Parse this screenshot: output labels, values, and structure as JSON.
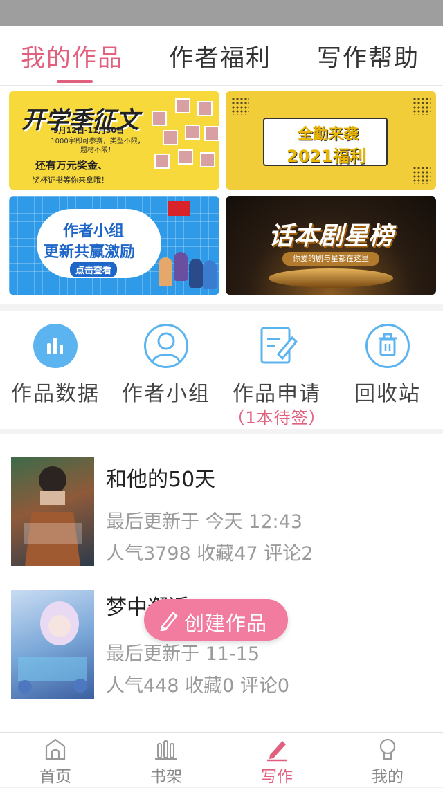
{
  "tabs": [
    {
      "label": "我的作品",
      "active": true
    },
    {
      "label": "作者福利",
      "active": false
    },
    {
      "label": "写作帮助",
      "active": false
    }
  ],
  "banners": {
    "b1": {
      "title": "开学季征文",
      "date": "9月12日-11月30日",
      "desc": "1000字即可参赛，类型不限，题材不限！",
      "prize": "还有万元奖金、",
      "prize2": "奖杯证书等你来拿哦！"
    },
    "b2": {
      "line1": "全勤来袭",
      "line2": "2021福利"
    },
    "b3": {
      "line1": "作者小组",
      "line2": "更新共赢激励",
      "button": "点击查看"
    },
    "b4": {
      "title": "话本剧星榜",
      "subtitle": "你爱的剧与星都在这里"
    }
  },
  "actions": [
    {
      "label": "作品数据",
      "icon": "chart-icon",
      "sub": ""
    },
    {
      "label": "作者小组",
      "icon": "group-icon",
      "sub": ""
    },
    {
      "label": "作品申请",
      "icon": "edit-doc-icon",
      "sub": "（1本待签）"
    },
    {
      "label": "回收站",
      "icon": "trash-icon",
      "sub": ""
    }
  ],
  "works": [
    {
      "title": "和他的50天",
      "updated": "最后更新于 今天 12:43",
      "stats": "人气3798 收藏47 评论2"
    },
    {
      "title": "梦中邂逅",
      "updated": "最后更新于 11-15",
      "stats": "人气448 收藏0 评论0"
    }
  ],
  "fab": {
    "label": "创建作品",
    "icon": "pencil-icon"
  },
  "nav": [
    {
      "label": "首页",
      "icon": "home-icon",
      "active": false
    },
    {
      "label": "书架",
      "icon": "bookshelf-icon",
      "active": false
    },
    {
      "label": "写作",
      "icon": "pen-icon",
      "active": true
    },
    {
      "label": "我的",
      "icon": "profile-icon",
      "active": false
    }
  ],
  "colors": {
    "accent": "#e0607e",
    "fab": "#f27ba0",
    "icon_blue": "#5bb4ef"
  }
}
